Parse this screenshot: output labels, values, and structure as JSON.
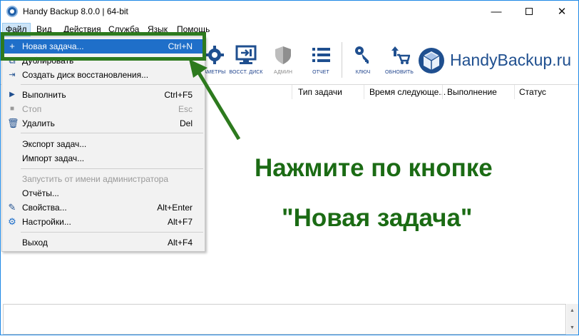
{
  "window": {
    "title": "Handy Backup 8.0.0 | 64-bit",
    "min_glyph": "—",
    "close_glyph": "✕"
  },
  "menubar": [
    {
      "label": "Файл"
    },
    {
      "label": "Вид"
    },
    {
      "label": "Действия"
    },
    {
      "label": "Служба"
    },
    {
      "label": "Язык"
    },
    {
      "label": "Помощь"
    }
  ],
  "toolbar": {
    "buttons": [
      {
        "label": "АМЕТРЫ",
        "icon": "gear-icon",
        "enabled": true
      },
      {
        "label": "ВОССТ. ДИСК",
        "icon": "restore-disk-icon",
        "enabled": true
      },
      {
        "label": "АДМИН",
        "icon": "shield-icon",
        "enabled": false
      },
      {
        "label": "ОТЧЕТ",
        "icon": "report-list-icon",
        "enabled": true
      },
      {
        "label": "КЛЮЧ",
        "icon": "key-icon",
        "enabled": true
      },
      {
        "label": "ОБНОВИТЬ",
        "icon": "update-cart-icon",
        "enabled": true
      }
    ],
    "brand": "HandyBackup.ru"
  },
  "columns": [
    "Тип задачи",
    "Время следующе...",
    "Выполнение",
    "Статус"
  ],
  "file_menu": [
    {
      "label": "Новая задача...",
      "shortcut": "Ctrl+N",
      "icon": "plus-icon",
      "enabled": true,
      "highlighted": true
    },
    {
      "label": "Дублировать",
      "shortcut": "",
      "icon": "duplicate-icon",
      "enabled": true
    },
    {
      "label": "Создать диск восстановления...",
      "shortcut": "",
      "icon": "recovery-disk-icon",
      "enabled": true
    },
    {
      "label": "Выполнить",
      "shortcut": "Ctrl+F5",
      "icon": "play-icon",
      "enabled": true
    },
    {
      "label": "Стоп",
      "shortcut": "Esc",
      "icon": "stop-icon",
      "enabled": false
    },
    {
      "label": "Удалить",
      "shortcut": "Del",
      "icon": "trash-icon",
      "enabled": true
    },
    {
      "label": "Экспорт задач...",
      "shortcut": "",
      "icon": "",
      "enabled": true
    },
    {
      "label": "Импорт задач...",
      "shortcut": "",
      "icon": "",
      "enabled": true
    },
    {
      "label": "Запустить от имени администратора",
      "shortcut": "",
      "icon": "",
      "enabled": false
    },
    {
      "label": "Отчёты...",
      "shortcut": "",
      "icon": "",
      "enabled": true
    },
    {
      "label": "Свойства...",
      "shortcut": "Alt+Enter",
      "icon": "pencil-icon",
      "enabled": true
    },
    {
      "label": "Настройки...",
      "shortcut": "Alt+F7",
      "icon": "settings-gear-icon",
      "enabled": true
    },
    {
      "label": "Выход",
      "shortcut": "Alt+F4",
      "icon": "",
      "enabled": true
    }
  ],
  "annotation": {
    "line1": "Нажмите по кнопке",
    "line2": "\"Новая задача\"",
    "color": "#2d7a1e"
  },
  "colors": {
    "highlight": "#1f6fc9",
    "brand": "#1f4f8f",
    "toolbar_label": "#1a3f8a"
  }
}
